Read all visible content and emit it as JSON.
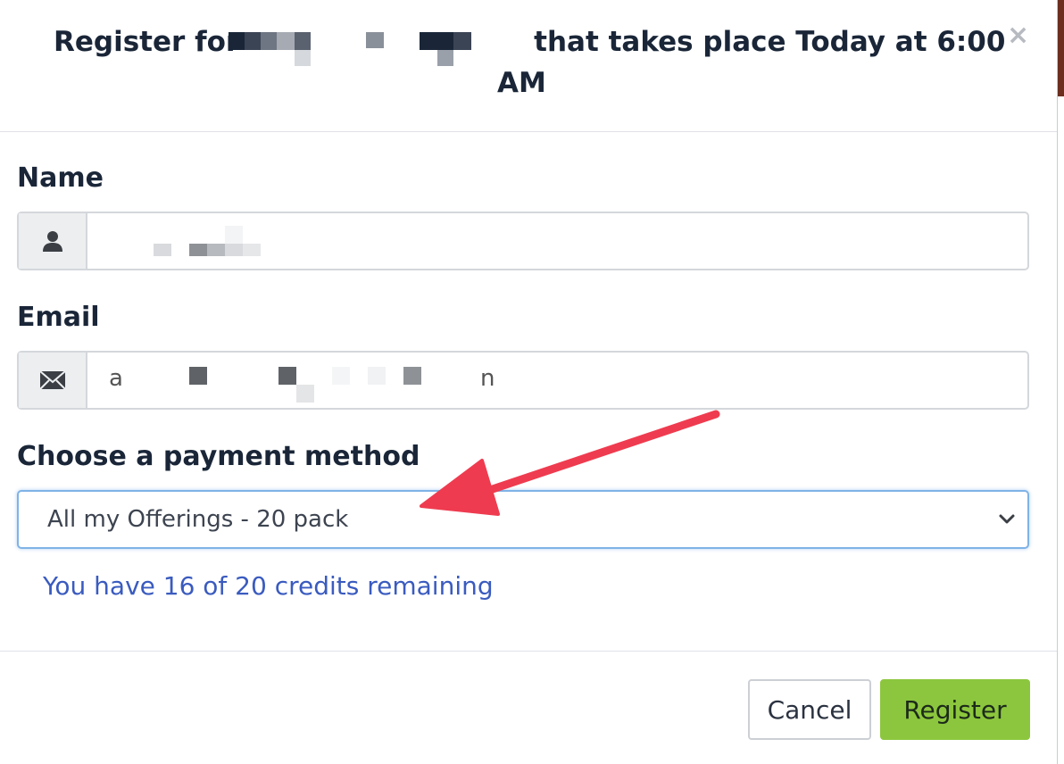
{
  "dialog": {
    "title_prefix": "Register for",
    "title_suffix": "that takes place Today at 6:00",
    "title_line2": "AM",
    "close_glyph": "×"
  },
  "form": {
    "name_label": "Name",
    "email_label": "Email",
    "email_visible_start": "a",
    "email_visible_end": "n",
    "payment_label": "Choose a payment method",
    "payment_selected": "All my Offerings - 20 pack",
    "credits_text": "You have 16 of 20 credits remaining"
  },
  "icons": {
    "name_icon": "user-icon",
    "email_icon": "envelope-icon",
    "select_icon": "chevron-down-icon",
    "close_icon": "close-icon"
  },
  "buttons": {
    "cancel": "Cancel",
    "register": "Register"
  },
  "colors": {
    "register_bg": "#8cc63e",
    "credits_text": "#3a5bbf",
    "focus_border": "#7fb3e6",
    "annotation_arrow": "#ef3b4f"
  }
}
